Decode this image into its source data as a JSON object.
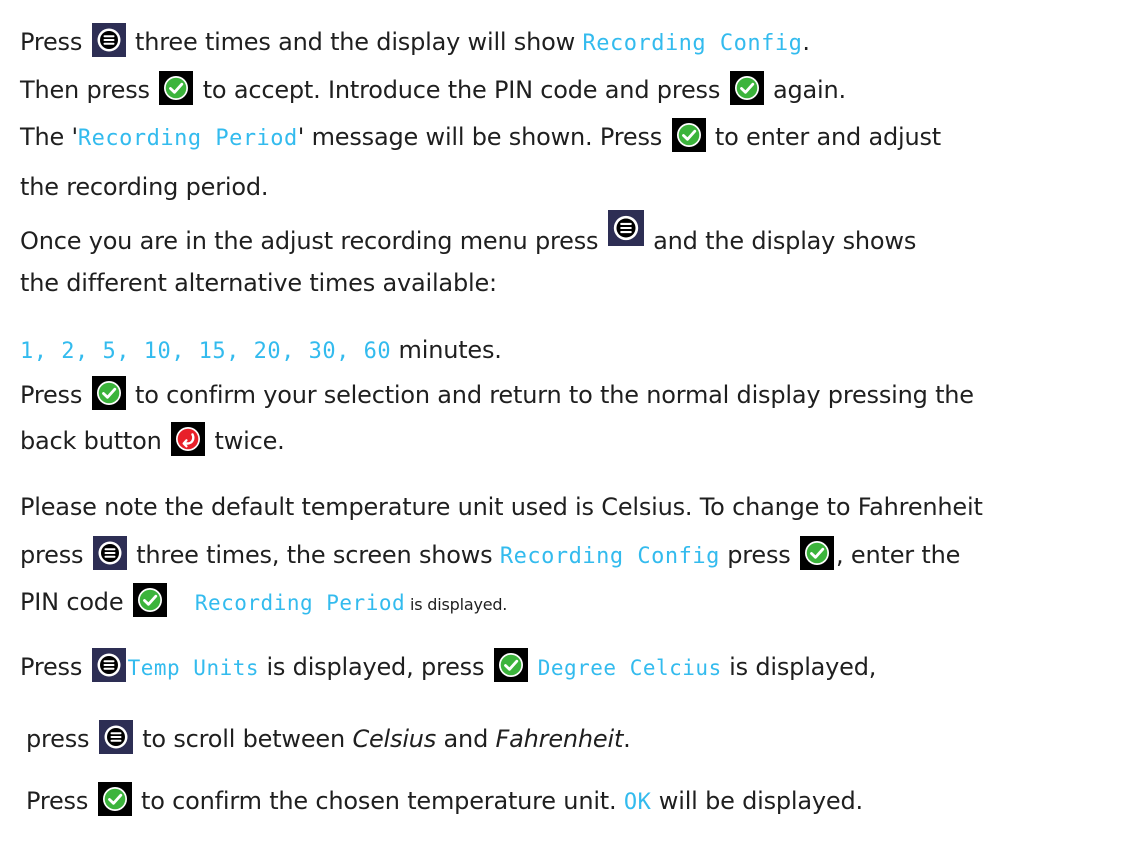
{
  "colors": {
    "text": "#1f1f1f",
    "lcd": "#33bbee",
    "menu_button_bg": "#2d2e54",
    "ok_button": "#3cb43c",
    "back_button": "#e8202a",
    "icon_bg": "#000000"
  },
  "icons": {
    "menu": "menu-button-icon",
    "ok": "ok-check-icon",
    "back": "back-arrow-icon"
  },
  "lines": {
    "l1": {
      "a": "Press ",
      "b": " three times and the display will show ",
      "lcd": "Recording Config",
      "c": "."
    },
    "l2": {
      "a": "Then press ",
      "b": " to accept. Introduce the PIN code and press ",
      "c": " again."
    },
    "l3": {
      "a": "The '",
      "lcd": "Recording Period",
      "b": "' message will be shown. Press ",
      "c": " to enter and adjust"
    },
    "l4": {
      "a": "the recording period."
    },
    "l5": {
      "a": "Once you are in the adjust recording menu press ",
      "b": " and the display shows"
    },
    "l6": {
      "a": "the different alternative times available:"
    },
    "l7": {
      "lcd": "1, 2, 5, 10, 15, 20, 30, 60",
      "a": " minutes."
    },
    "l8": {
      "a": "Press ",
      "b": " to confirm your selection and return to the normal display pressing the"
    },
    "l9": {
      "a": "back button ",
      "b": " twice."
    },
    "l10": {
      "a": "Please note the default temperature unit used is Celsius. To change to Fahrenheit"
    },
    "l11": {
      "a": "press ",
      "b": " three times, the screen shows ",
      "lcd": "Recording Config",
      "c": " press ",
      "d": ", enter the"
    },
    "l12": {
      "a": "PIN code ",
      "lcd": "Recording Period",
      "b": " is displayed."
    },
    "l13": {
      "a": "Press ",
      "lcd1": "Temp Units",
      "b": " is displayed, press ",
      "lcd2": "Degree Celcius",
      "c": " is displayed,"
    },
    "l14": {
      "a": "press ",
      "b": " to scroll between ",
      "i1": "Celsius",
      "c": " and ",
      "i2": "Fahrenheit",
      "d": "."
    },
    "l15": {
      "a": "Press ",
      "b": " to confirm the chosen temperature unit. ",
      "lcd": "OK",
      "c": " will be displayed."
    }
  }
}
